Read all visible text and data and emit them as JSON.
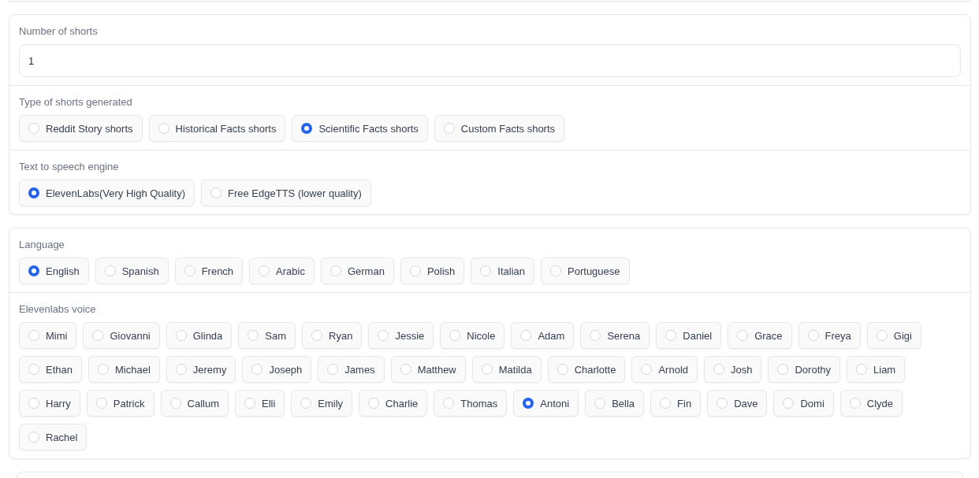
{
  "panels": [
    {
      "sections": [
        {
          "kind": "number",
          "label": "Number of shorts",
          "value": "1"
        },
        {
          "kind": "radio",
          "label": "Type of shorts generated",
          "options": [
            {
              "label": "Reddit Story shorts",
              "selected": false
            },
            {
              "label": "Historical Facts shorts",
              "selected": false
            },
            {
              "label": "Scientific Facts shorts",
              "selected": true
            },
            {
              "label": "Custom Facts shorts",
              "selected": false
            }
          ]
        },
        {
          "kind": "radio",
          "label": "Text to speech engine",
          "options": [
            {
              "label": "ElevenLabs(Very High Quality)",
              "selected": true
            },
            {
              "label": "Free EdgeTTS (lower quality)",
              "selected": false
            }
          ]
        }
      ]
    },
    {
      "sections": [
        {
          "kind": "radio",
          "label": "Language",
          "options": [
            {
              "label": "English",
              "selected": true
            },
            {
              "label": "Spanish",
              "selected": false
            },
            {
              "label": "French",
              "selected": false
            },
            {
              "label": "Arabic",
              "selected": false
            },
            {
              "label": "German",
              "selected": false
            },
            {
              "label": "Polish",
              "selected": false
            },
            {
              "label": "Italian",
              "selected": false
            },
            {
              "label": "Portuguese",
              "selected": false
            }
          ]
        },
        {
          "kind": "radio",
          "label": "Elevenlabs voice",
          "options": [
            {
              "label": "Mimi",
              "selected": false
            },
            {
              "label": "Giovanni",
              "selected": false
            },
            {
              "label": "Glinda",
              "selected": false
            },
            {
              "label": "Sam",
              "selected": false
            },
            {
              "label": "Ryan",
              "selected": false
            },
            {
              "label": "Jessie",
              "selected": false
            },
            {
              "label": "Nicole",
              "selected": false
            },
            {
              "label": "Adam",
              "selected": false
            },
            {
              "label": "Serena",
              "selected": false
            },
            {
              "label": "Daniel",
              "selected": false
            },
            {
              "label": "Grace",
              "selected": false
            },
            {
              "label": "Freya",
              "selected": false
            },
            {
              "label": "Gigi",
              "selected": false
            },
            {
              "label": "Ethan",
              "selected": false
            },
            {
              "label": "Michael",
              "selected": false
            },
            {
              "label": "Jeremy",
              "selected": false
            },
            {
              "label": "Joseph",
              "selected": false
            },
            {
              "label": "James",
              "selected": false
            },
            {
              "label": "Matthew",
              "selected": false
            },
            {
              "label": "Matilda",
              "selected": false
            },
            {
              "label": "Charlotte",
              "selected": false
            },
            {
              "label": "Arnold",
              "selected": false
            },
            {
              "label": "Josh",
              "selected": false
            },
            {
              "label": "Dorothy",
              "selected": false
            },
            {
              "label": "Liam",
              "selected": false
            },
            {
              "label": "Harry",
              "selected": false
            },
            {
              "label": "Patrick",
              "selected": false
            },
            {
              "label": "Callum",
              "selected": false
            },
            {
              "label": "Elli",
              "selected": false
            },
            {
              "label": "Emily",
              "selected": false
            },
            {
              "label": "Charlie",
              "selected": false
            },
            {
              "label": "Thomas",
              "selected": false
            },
            {
              "label": "Antoni",
              "selected": true
            },
            {
              "label": "Bella",
              "selected": false
            },
            {
              "label": "Fin",
              "selected": false
            },
            {
              "label": "Dave",
              "selected": false
            },
            {
              "label": "Domi",
              "selected": false
            },
            {
              "label": "Clyde",
              "selected": false
            },
            {
              "label": "Rachel",
              "selected": false
            }
          ]
        }
      ]
    }
  ]
}
